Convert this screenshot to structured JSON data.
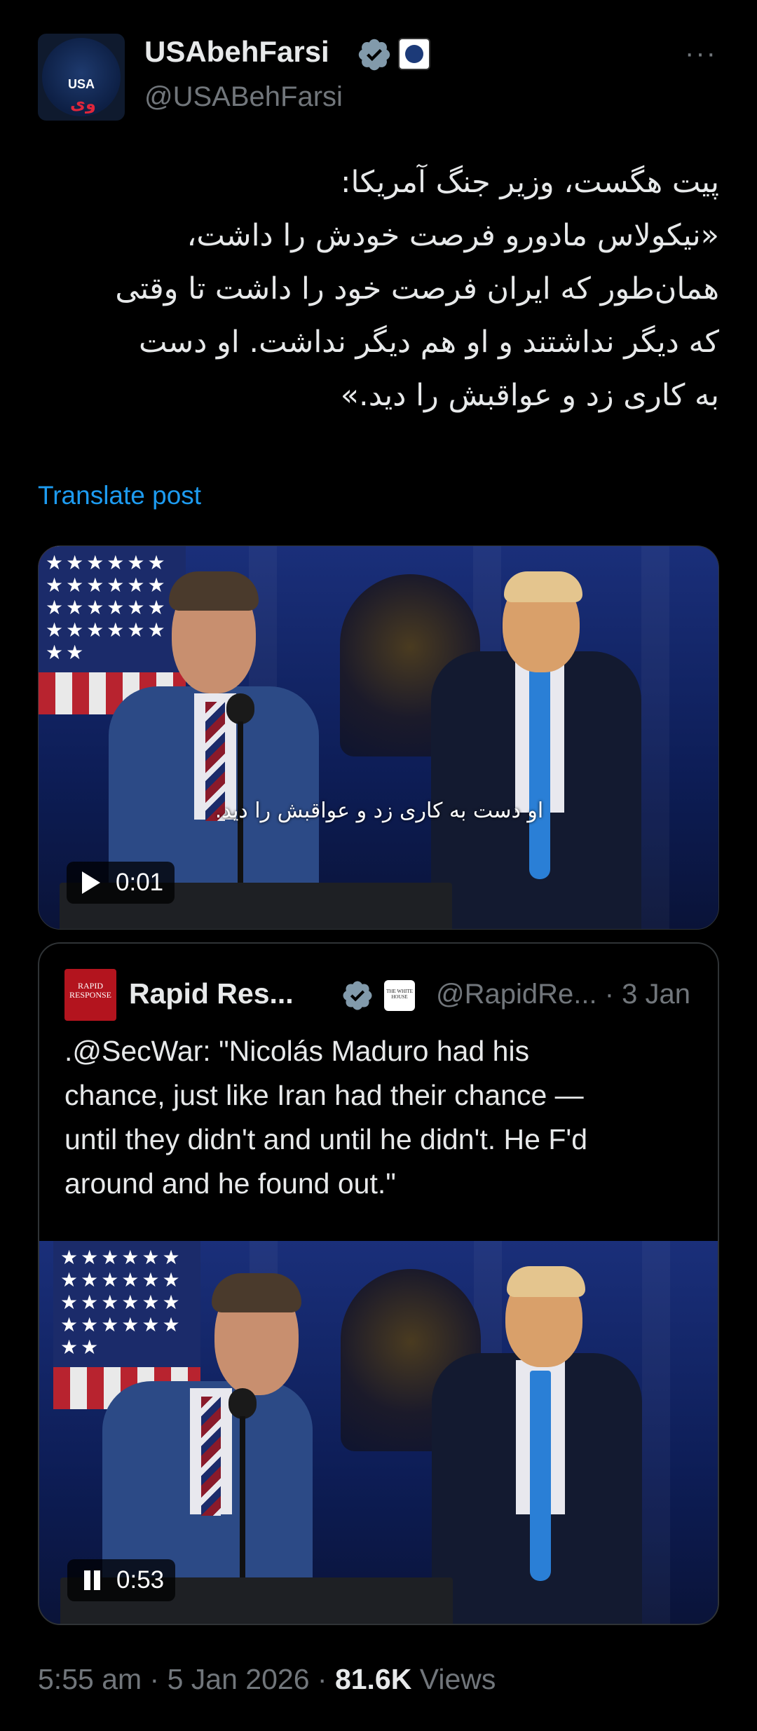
{
  "author": {
    "display_name": "USAbehFarsi",
    "handle": "@USABehFarsi",
    "avatar_text": "USA",
    "avatar_accent": "وی",
    "verified_color": "#829aab"
  },
  "more_label": "···",
  "post": {
    "lines": [
      "پیت هگست، وزیر جنگ آمریکا:",
      "«نیکولاس مادورو فرصت خودش را داشت،",
      "همان‌طور که ایران فرصت خود را داشت تا وقتی",
      "که دیگر نداشتند و او هم دیگر نداشت. او دست",
      "به کاری زد و عواقبش را دید.»"
    ]
  },
  "translate_label": "Translate post",
  "video1": {
    "subtitle": "او دست به کاری زد و عواقبش را دید.",
    "time": "0:01",
    "state": "play"
  },
  "quote": {
    "logo_text": "RAPID RESPONSE",
    "display_name": "Rapid Res...",
    "affil_text": "THE WHITE HOUSE",
    "handle_date": "@RapidRe... · 3 Jan",
    "lines": [
      ".@SecWar: \"Nicolás Maduro had his",
      "chance, just like Iran had their chance —",
      "until they didn't and until he didn't. He F'd",
      "around and he found out.\""
    ],
    "video": {
      "time": "0:53",
      "state": "pause"
    }
  },
  "meta": {
    "time": "5:55 am",
    "sep1": " · ",
    "date": "5 Jan 2026",
    "sep2": " · ",
    "views_count": "81.6K",
    "views_label": " Views"
  },
  "colors": {
    "background": "#000000",
    "text": "#e7e9ea",
    "muted": "#71767b",
    "link": "#1d9bf0",
    "border": "#2f3336"
  }
}
